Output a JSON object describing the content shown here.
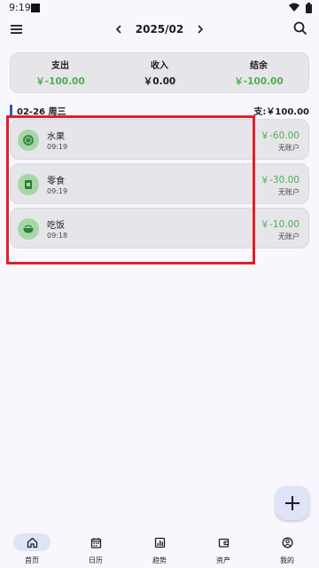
{
  "status": {
    "time": "9:19"
  },
  "header": {
    "month": "2025/02"
  },
  "summary": [
    {
      "label": "支出",
      "value": "￥-100.00"
    },
    {
      "label": "收入",
      "value": "￥0.00"
    },
    {
      "label": "结余",
      "value": "￥-100.00"
    }
  ],
  "day": {
    "date": "02-26 周三",
    "total": "支:￥100.00"
  },
  "records": [
    {
      "name": "水果",
      "time": "09:19",
      "amount": "￥-60.00",
      "account": "无账户",
      "icon": "fruit-icon"
    },
    {
      "name": "零食",
      "time": "09:19",
      "amount": "￥-30.00",
      "account": "无账户",
      "icon": "snack-icon"
    },
    {
      "name": "吃饭",
      "time": "09:18",
      "amount": "￥-10.00",
      "account": "无账户",
      "icon": "meal-icon"
    }
  ],
  "nav": [
    {
      "label": "首页",
      "icon": "home-icon"
    },
    {
      "label": "日历",
      "icon": "calendar-icon"
    },
    {
      "label": "趋势",
      "icon": "chart-icon"
    },
    {
      "label": "资产",
      "icon": "wallet-icon"
    },
    {
      "label": "我的",
      "icon": "profile-icon"
    }
  ],
  "colors": {
    "expense": "#4caf50",
    "accent": "#3f51b5",
    "highlight": "#e0202a"
  }
}
